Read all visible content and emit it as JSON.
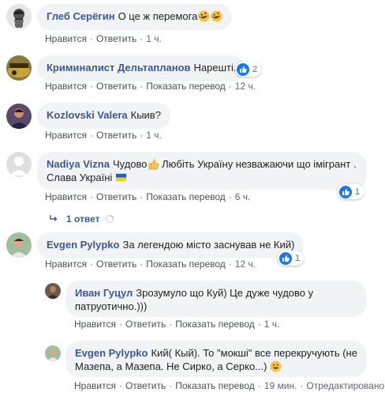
{
  "comments": [
    {
      "author": "Глеб Серёгин",
      "text": "О це ж перемога",
      "emoji": [
        "rofl-emoji",
        "rofl-emoji"
      ],
      "actions": [
        "Нравится",
        "Ответить"
      ],
      "time": "1 ч."
    },
    {
      "author": "Криминалист Дельтапланов",
      "text": "Нарешті.",
      "reactions": "2",
      "actions": [
        "Нравится",
        "Ответить",
        "Показать перевод"
      ],
      "time": "12 ч."
    },
    {
      "author": "Kozlovski Valera",
      "text": "Кыив?",
      "actions": [
        "Нравится",
        "Ответить"
      ],
      "time": "1 ч."
    },
    {
      "author": "Nadiya Vizna",
      "text": "Чудово",
      "text2": " Любіть Україну незважаючи що імігрант .",
      "text3": "Слава Україні",
      "reactions": "1",
      "actions": [
        "Нравится",
        "Ответить",
        "Показать перевод"
      ],
      "time": "6 ч.",
      "replies": "1 ответ"
    },
    {
      "author": "Evgen Pylypko",
      "text": "За легендою місто заснував не Кий)",
      "reactions": "1",
      "actions": [
        "Нравится",
        "Ответить",
        "Показать перевод"
      ],
      "time": "12 ч."
    }
  ],
  "replies": [
    {
      "author": "Иван Гуцул",
      "text": "Зрозумуло що Куй) Це дуже чудово у патруотично.)))",
      "actions": [
        "Нравится",
        "Ответить",
        "Показать перевод"
      ],
      "time": "1 ч."
    },
    {
      "author": "Evgen Pylypko",
      "text": "Кий( Кый). То \"мокші\" все перекручують (не Мазепа, а Мазепа. Не Сирко, а Серко...)",
      "actions": [
        "Нравится",
        "Ответить",
        "Показать перевод"
      ],
      "time": "19 мин.",
      "edited": "Отредактировано"
    }
  ],
  "colors": {
    "link": "#385898",
    "bubble": "#f2f3f5",
    "like": "#1877f2"
  }
}
